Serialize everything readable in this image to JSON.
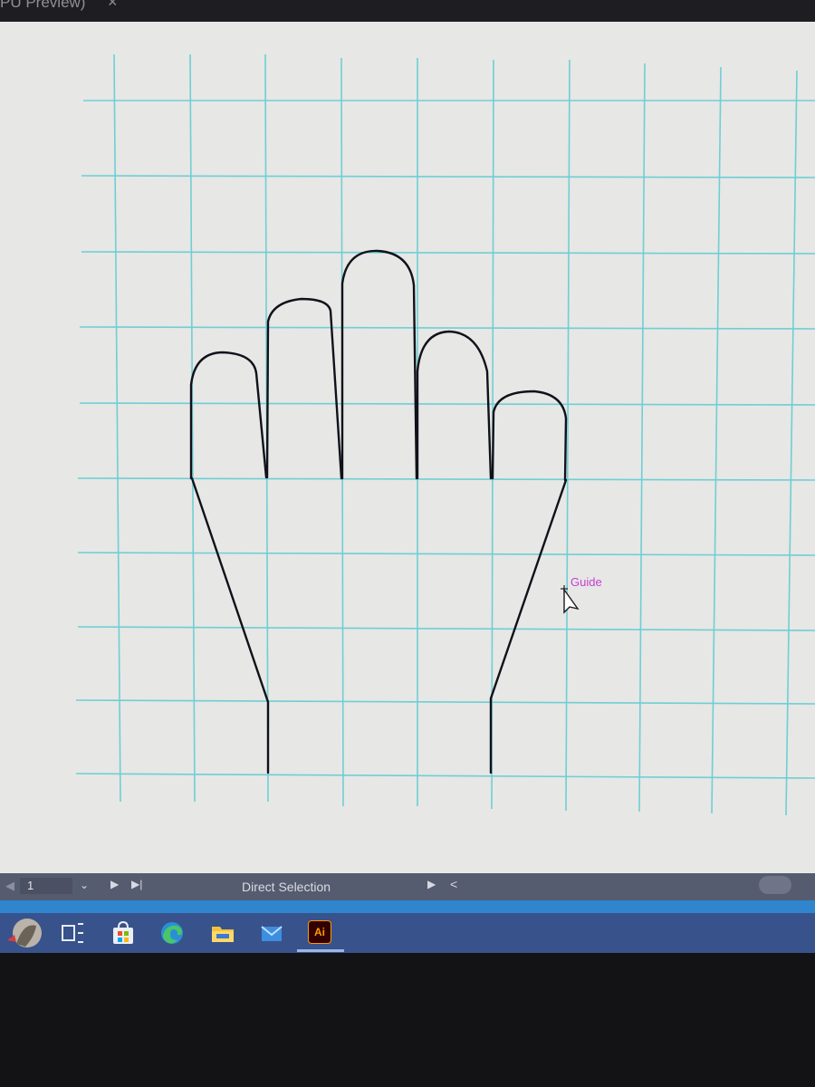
{
  "window": {
    "tab_title": "PU Preview)",
    "tab_close": "×"
  },
  "canvas": {
    "guide_label": "Guide",
    "guide_color": "#6ecfd3",
    "guide_label_color": "#c43fd0",
    "path_color": "#10121a"
  },
  "status_bar": {
    "page_number": "1",
    "tool_name": "Direct Selection",
    "prev_icon": "◀",
    "dropdown_icon": "⌄",
    "next_icon": "▶",
    "last_icon": "▶|",
    "play_icon": "▶",
    "back_icon": "<"
  },
  "taskbar": {
    "apps": [
      {
        "name": "user-avatar-icon"
      },
      {
        "name": "task-view-icon"
      },
      {
        "name": "microsoft-store-icon"
      },
      {
        "name": "edge-browser-icon"
      },
      {
        "name": "file-explorer-icon"
      },
      {
        "name": "mail-icon"
      },
      {
        "name": "illustrator-icon",
        "label": "Ai",
        "active": true
      }
    ]
  }
}
